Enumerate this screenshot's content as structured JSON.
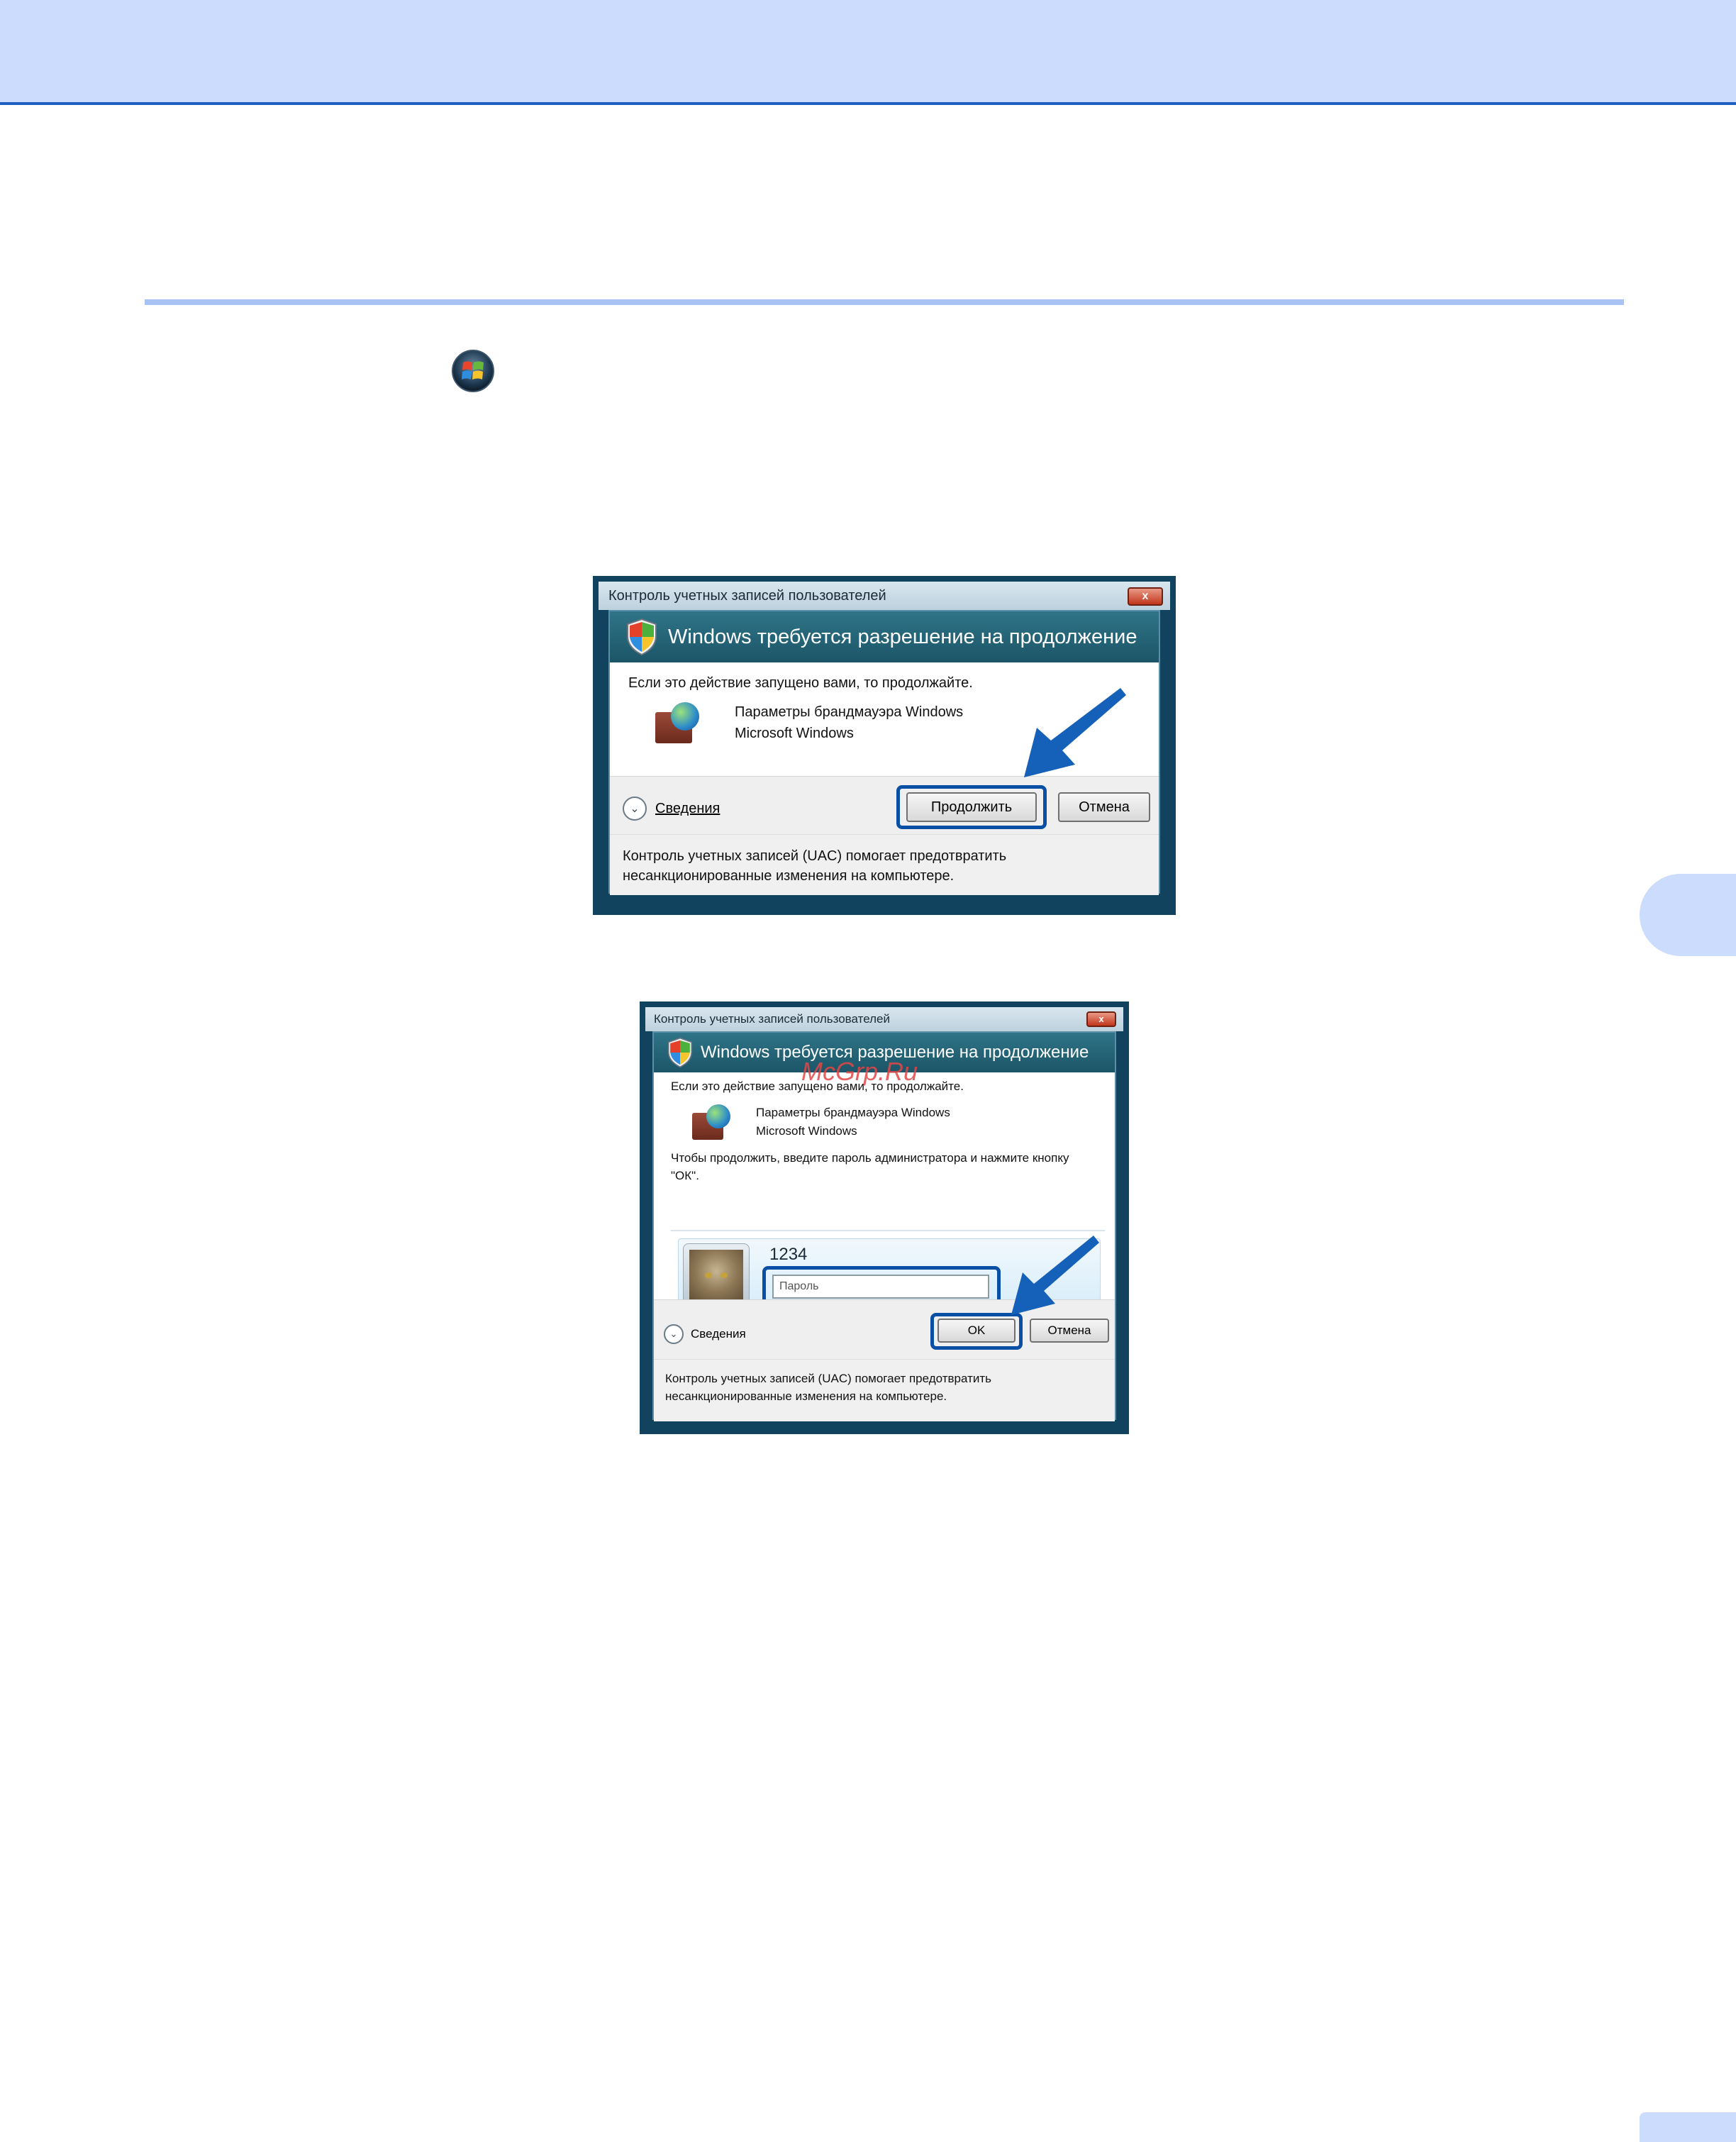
{
  "watermark": "McGrp.Ru",
  "dialog_continue": {
    "title": "Контроль учетных записей пользователей",
    "close_label": "x",
    "banner": "Windows требуется разрешение на продолжение",
    "intro": "Если это действие запущено вами, то продолжайте.",
    "program_name": "Параметры брандмауэра Windows",
    "publisher": "Microsoft Windows",
    "details_label": "Сведения",
    "continue_label": "Продолжить",
    "cancel_label": "Отмена",
    "note_line1": "Контроль учетных записей (UAC) помогает предотвратить",
    "note_line2": "несанкционированные изменения на компьютере."
  },
  "dialog_password": {
    "title": "Контроль учетных записей пользователей",
    "close_label": "x",
    "banner": "Windows требуется разрешение на продолжение",
    "intro": "Если это действие запущено вами, то продолжайте.",
    "program_name": "Параметры брандмауэра Windows",
    "publisher": "Microsoft Windows",
    "instruction": "Чтобы продолжить, введите пароль администратора и нажмите кнопку \"ОК\".",
    "username": "1234",
    "password_placeholder": "Пароль",
    "details_label": "Сведения",
    "ok_label": "OK",
    "cancel_label": "Отмена",
    "note_line1": "Контроль учетных записей (UAC) помогает предотвратить",
    "note_line2": "несанкционированные изменения на компьютере."
  },
  "colors": {
    "header_band": "#ccdcfc",
    "header_rule": "#1f5fc2",
    "section_rule": "#a8c2f4",
    "highlight": "#0a4fa6",
    "arrow": "#1560b8"
  },
  "icons": [
    "windows-start-orb-icon",
    "uac-shield-icon",
    "firewall-icon",
    "chevron-down-icon",
    "close-icon",
    "pointer-arrow-icon"
  ]
}
